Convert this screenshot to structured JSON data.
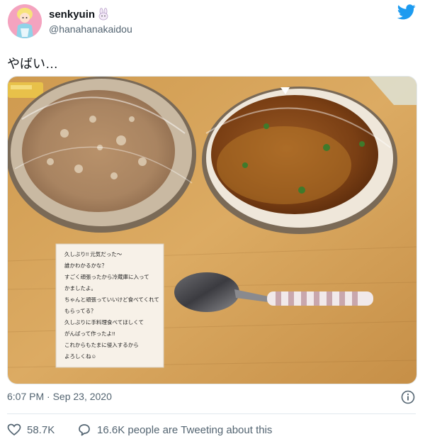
{
  "tweet": {
    "display_name": "senkyuin",
    "handle": "@hanahanakaidou",
    "text": "やばい…",
    "timestamp": "6:07 PM · Sep 23, 2020",
    "likes": "58.7K",
    "tweeting_label": "16.6K people are Tweeting about this"
  },
  "note": {
    "lines": [
      "久しぶり!! 元気だった〜",
      "誰かわかるかな？",
      "すごく頑張ったから冷蔵庫に入って",
      "かましたよ。",
      "ちゃんと頑張っていいけど食べてくれて",
      "もらってる？",
      "久しぶりに手料理食べてほしくて",
      "がんばって作ったよ!!",
      "これからもたまに侵入するから",
      "よろしくね☺"
    ]
  },
  "icons": {
    "name_emoji": "rabbit-emoji-icon",
    "brand": "twitter-bird-icon",
    "info": "info-icon",
    "like": "heart-icon",
    "reply": "speech-bubble-icon"
  },
  "colors": {
    "twitter_blue": "#1d9bf0",
    "text_secondary": "#536471",
    "table_wood": "#d9a85c"
  }
}
